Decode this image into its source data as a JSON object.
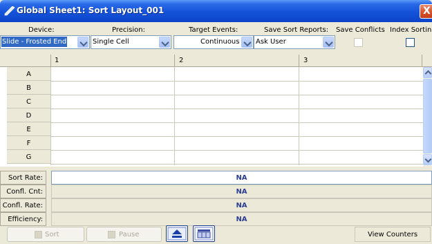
{
  "window": {
    "title": "Global Sheet1: Sort Layout_001",
    "close_label": "X"
  },
  "fields": {
    "device": {
      "label": "Device:",
      "value": "Slide - Frosted End"
    },
    "precision": {
      "label": "Precision:",
      "value": "Single Cell"
    },
    "target_events": {
      "label": "Target Events:",
      "value": "Continuous"
    },
    "save_sort_reports": {
      "label": "Save Sort Reports:",
      "value": "Ask User"
    },
    "save_conflicts": {
      "label": "Save Conflicts",
      "checked": false,
      "enabled": false
    },
    "index_sorting": {
      "label": "Index Sorting",
      "checked": false,
      "enabled": true
    }
  },
  "grid": {
    "columns": [
      "1",
      "2",
      "3"
    ],
    "rows": [
      "A",
      "B",
      "C",
      "D",
      "E",
      "F",
      "G"
    ]
  },
  "stats": [
    {
      "label": "Sort Rate:",
      "value": "NA"
    },
    {
      "label": "Confl. Cnt:",
      "value": "NA"
    },
    {
      "label": "Confl. Rate:",
      "value": "NA"
    },
    {
      "label": "Efficiency:",
      "value": "NA"
    }
  ],
  "toolbar": {
    "sort_label": "Sort",
    "pause_label": "Pause",
    "view_counters_label": "View Counters"
  },
  "colors": {
    "title_bar": "#1453d9",
    "selection": "#316ac5",
    "stat_value": "#2c3e92",
    "panel": "#ece9d8"
  }
}
